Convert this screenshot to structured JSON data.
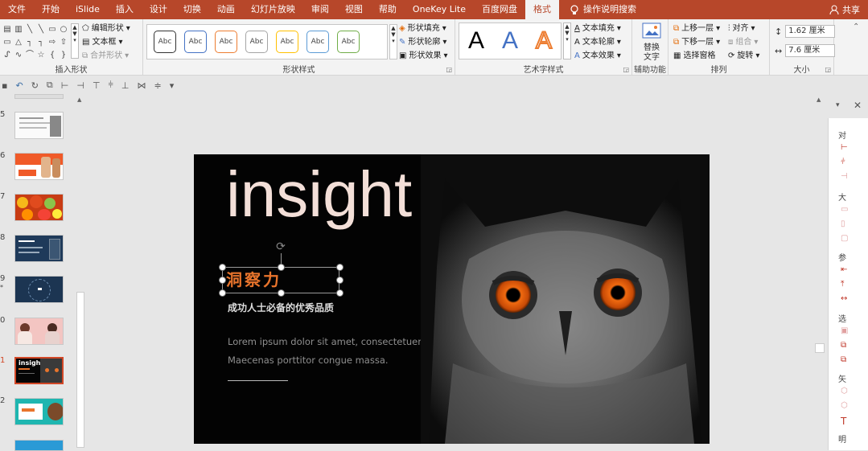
{
  "tabs": [
    "文件",
    "开始",
    "iSlide",
    "插入",
    "设计",
    "切换",
    "动画",
    "幻灯片放映",
    "审阅",
    "视图",
    "帮助",
    "OneKey Lite",
    "百度网盘",
    "格式"
  ],
  "active_tab": "格式",
  "tell_me": "操作说明搜索",
  "share": "共享",
  "ribbon": {
    "insert_shapes": {
      "label": "插入形状",
      "edit_shape": "编辑形状",
      "text_box": "文本框",
      "merge_shapes": "合并形状"
    },
    "shape_styles": {
      "label": "形状样式",
      "swatch_text": "Abc",
      "swatch_colors": [
        "#333333",
        "#4472c4",
        "#ed7d31",
        "#a5a5a5",
        "#ffc000",
        "#5b9bd5",
        "#70ad47"
      ],
      "fill": "形状填充",
      "outline": "形状轮廓",
      "effects": "形状效果"
    },
    "wordart": {
      "label": "艺术字样式",
      "letter": "A",
      "text_fill": "文本填充",
      "text_outline": "文本轮廓",
      "text_effects": "文本效果"
    },
    "accessibility": {
      "label": "辅助功能",
      "alt_text_1": "替换",
      "alt_text_2": "文字"
    },
    "arrange": {
      "label": "排列",
      "bring_forward": "上移一层",
      "send_backward": "下移一层",
      "selection_pane": "选择窗格",
      "align": "对齐",
      "group": "组合",
      "rotate": "旋转"
    },
    "size": {
      "label": "大小",
      "height": "1.62 厘米",
      "width": "7.6 厘米"
    }
  },
  "thumbnails": [
    {
      "num": "5"
    },
    {
      "num": "6"
    },
    {
      "num": "7"
    },
    {
      "num": "8"
    },
    {
      "num": "9",
      "star": "*"
    },
    {
      "num": "0"
    },
    {
      "num": "1",
      "selected": true
    },
    {
      "num": "2"
    }
  ],
  "slide": {
    "title": "insight",
    "heading": "洞察力",
    "subtitle": "成功人士必备的优秀品质",
    "body_line1": "Lorem ipsum dolor sit amet, consectetuer adipi",
    "body_line2": "Maecenas porttitor congue massa.",
    "accent_color": "#e8742c",
    "title_color": "#f3dfd8"
  },
  "thumb_texts": {
    "insight": "insight"
  },
  "right_pane": {
    "labels": [
      "对",
      "大",
      "参",
      "选",
      "矢",
      "明"
    ]
  }
}
